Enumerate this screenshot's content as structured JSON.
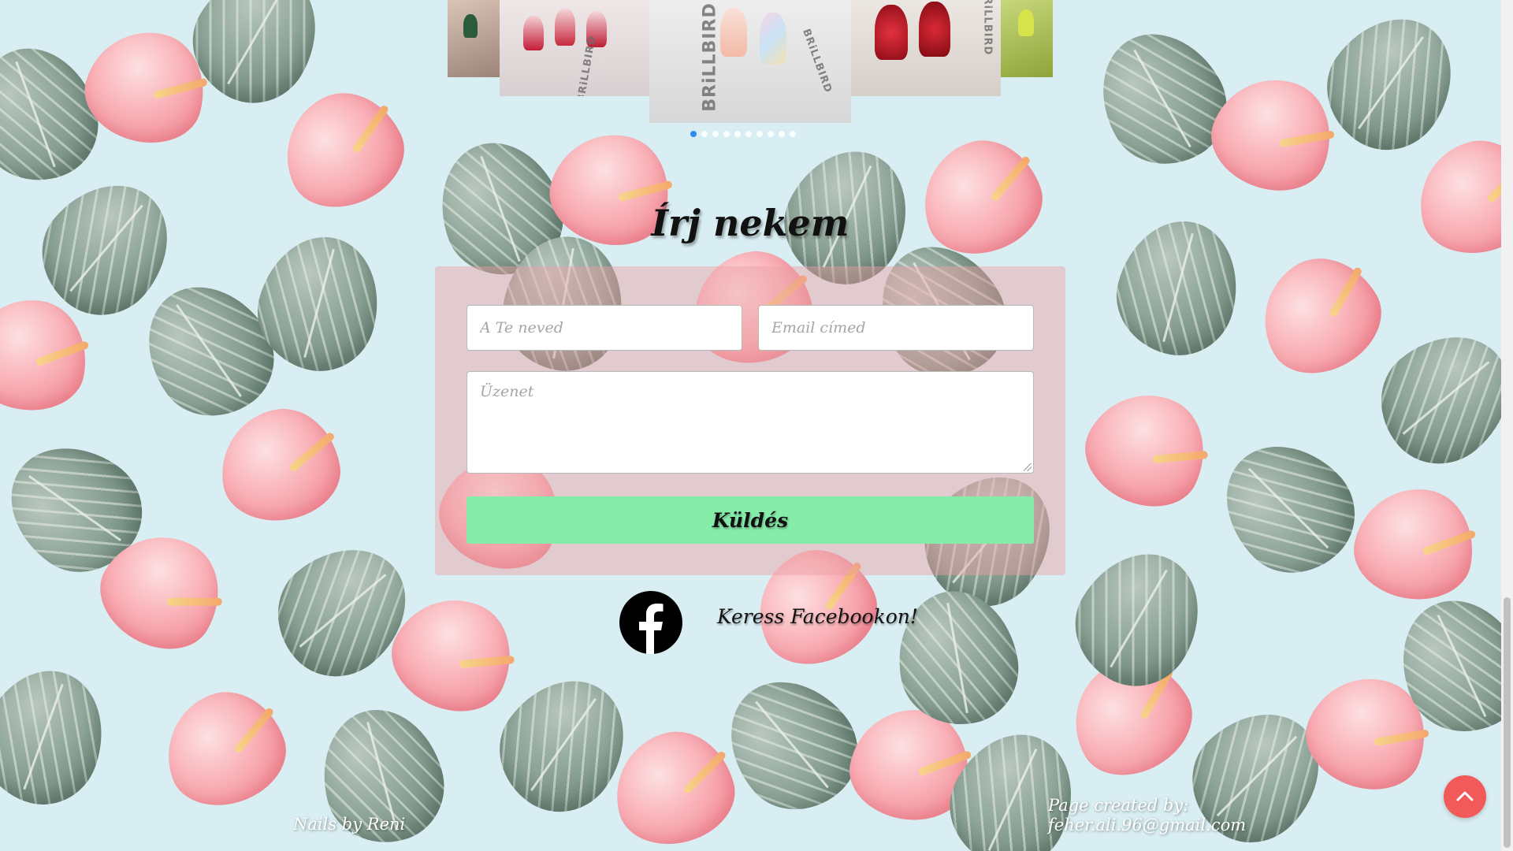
{
  "gallery": {
    "brand_text": "BRiLLBIRD",
    "slide_count": 10,
    "active_slide": 1
  },
  "contact": {
    "title": "Írj nekem",
    "name_placeholder": "A Te neved",
    "email_placeholder": "Email címed",
    "message_placeholder": "Üzenet",
    "send_label": "Küldés"
  },
  "social": {
    "facebook_label": "Keress Facebookon!",
    "facebook_icon": "facebook-icon"
  },
  "footer": {
    "brand": "Nails by Reni",
    "credit_line1": "Page created by:",
    "credit_line2": "feher.ali.96@gmail.com"
  },
  "colors": {
    "background": "#d9eef2",
    "send_button": "#86ecaa",
    "back_to_top": "#f25a5a",
    "active_dot": "#2d8cf0"
  },
  "icons": {
    "back_to_top": "chevron-up-icon"
  }
}
